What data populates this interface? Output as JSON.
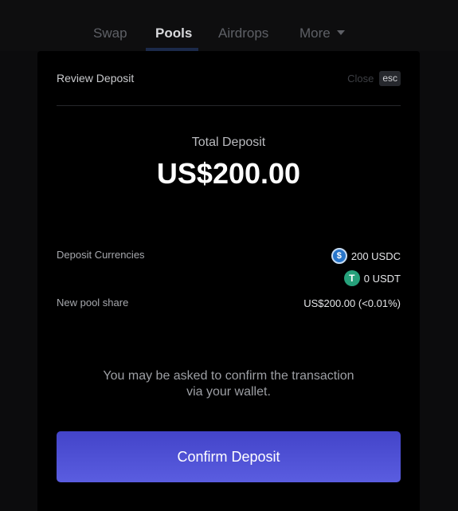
{
  "nav": {
    "items": [
      {
        "label": "Swap"
      },
      {
        "label": "Pools"
      },
      {
        "label": "Airdrops"
      },
      {
        "label": "More"
      }
    ],
    "active": "Pools"
  },
  "modal": {
    "title": "Review Deposit",
    "close_label": "Close",
    "close_key": "esc",
    "total_label": "Total Deposit",
    "total_value": "US$200.00",
    "deposit_currencies_label": "Deposit Currencies",
    "currencies": [
      {
        "icon": "usdc-icon",
        "glyph": "$",
        "amount": "200 USDC",
        "color": "#2775ca"
      },
      {
        "icon": "usdt-icon",
        "glyph": "T",
        "amount": "0 USDT",
        "color": "#26a17b"
      }
    ],
    "pool_share_label": "New pool share",
    "pool_share_value": "US$200.00 (<0.01%)",
    "notice_line1": "You may be asked to confirm the transaction",
    "notice_line2": "via your wallet.",
    "confirm_label": "Confirm Deposit"
  },
  "colors": {
    "background": "#0c0c0d",
    "modal": "#000000",
    "button_top": "#4344c9",
    "button_bottom": "#5a5de0"
  }
}
